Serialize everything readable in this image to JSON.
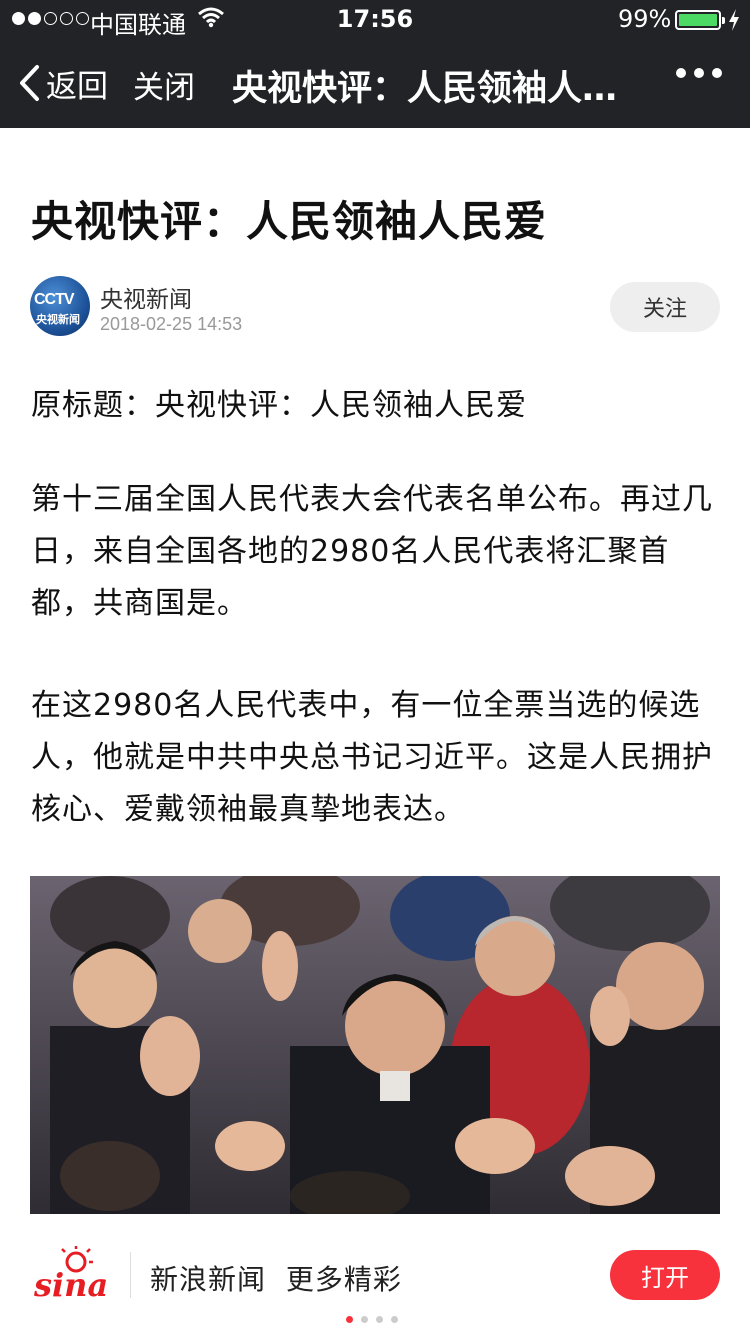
{
  "status_bar": {
    "carrier": "中国联通",
    "time": "17:56",
    "battery": "99%",
    "battery_level": 0.99
  },
  "nav": {
    "back_label": "返回",
    "close_label": "关闭",
    "title": "央视快评：人民领袖人…"
  },
  "article": {
    "headline": "央视快评：人民领袖人民爱",
    "author": "央视新闻",
    "avatar_text": "CCTV",
    "avatar_subtext": "央视新闻",
    "timestamp": "2018-02-25 14:53",
    "follow_label": "关注",
    "paragraphs": [
      "原标题：央视快评：人民领袖人民爱",
      "第十三届全国人民代表大会代表名单公布。再过几日，来自全国各地的2980名人民代表将汇聚首都，共商国是。",
      "在这2980名人民代表中，有一位全票当选的候选人，他就是中共中央总书记习近平。这是人民拥护核心、爱戴领袖最真挚地表达。"
    ]
  },
  "footer": {
    "logo_text": "sina",
    "promo_left": "新浪新闻",
    "promo_right": "更多精彩",
    "open_label": "打开"
  },
  "colors": {
    "nav_bg": "#222326",
    "accent_red": "#f7323c",
    "battery_green": "#4cd964"
  }
}
